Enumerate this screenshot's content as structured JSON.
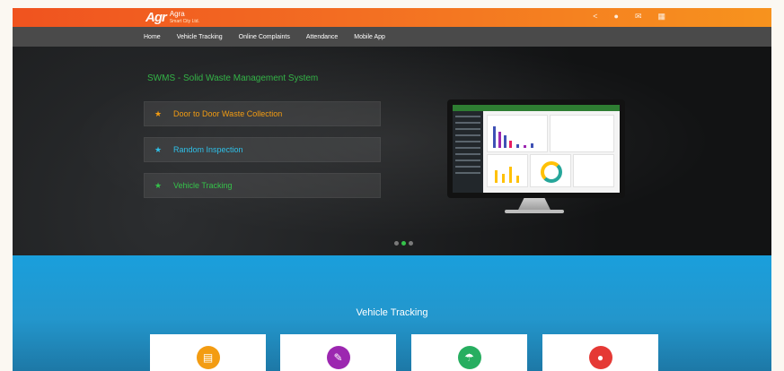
{
  "header": {
    "logo_mark": "Agr",
    "logo_name": "Agra",
    "logo_sub": "Smart City Ltd.",
    "icons": [
      "share-icon",
      "user-icon",
      "mail-icon",
      "grid-icon"
    ]
  },
  "nav": {
    "items": [
      "Home",
      "Vehicle Tracking",
      "Online Complaints",
      "Attendance",
      "Mobile App"
    ]
  },
  "hero": {
    "title": "SWMS - Solid Waste Management System",
    "features": [
      {
        "label": "Door to Door Waste Collection",
        "color": "#f39c12",
        "icon": "star-icon"
      },
      {
        "label": "Random Inspection",
        "color": "#2fc0e8",
        "icon": "star-icon"
      },
      {
        "label": "Vehicle Tracking",
        "color": "#35c24a",
        "icon": "star-icon"
      }
    ],
    "slider": {
      "slides": 3,
      "active": 2
    }
  },
  "section": {
    "title": "Vehicle Tracking",
    "tiles": [
      {
        "icon": "truck-icon",
        "color": "#f39c12"
      },
      {
        "icon": "edit-icon",
        "color": "#9c27b0"
      },
      {
        "icon": "umbrella-icon",
        "color": "#27ae60"
      },
      {
        "icon": "user-icon",
        "color": "#e53935"
      }
    ]
  },
  "colors": {
    "topbar_start": "#f0531f",
    "topbar_end": "#f7931e",
    "navbar": "#4a4a4a",
    "section_blue": "#1a9fdc",
    "accent_green": "#35c24a"
  }
}
